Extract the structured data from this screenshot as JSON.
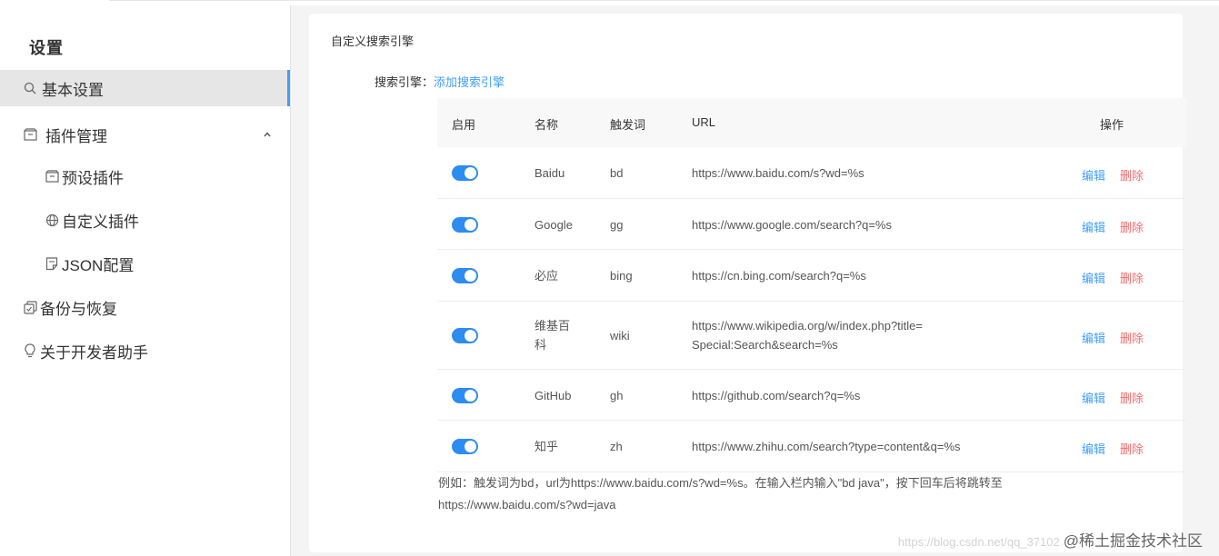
{
  "sidebar": {
    "title": "设置",
    "items": [
      {
        "label": "基本设置",
        "icon": "search-icon"
      },
      {
        "label": "插件管理",
        "icon": "box-icon"
      },
      {
        "label": "预设插件",
        "icon": "box-icon"
      },
      {
        "label": "自定义插件",
        "icon": "globe-icon"
      },
      {
        "label": "JSON配置",
        "icon": "document-icon"
      },
      {
        "label": "备份与恢复",
        "icon": "copy-icon"
      },
      {
        "label": "关于开发者助手",
        "icon": "lightbulb-icon"
      }
    ]
  },
  "card": {
    "title": "自定义搜索引擎",
    "engine_label": "搜索引擎：",
    "add_link": "添加搜索引擎"
  },
  "table": {
    "headers": {
      "enable": "启用",
      "name": "名称",
      "keyword": "触发词",
      "url": "URL",
      "actions": "操作"
    },
    "edit_label": "编辑",
    "delete_label": "删除",
    "rows": [
      {
        "name": "Baidu",
        "keyword": "bd",
        "url": "https://www.baidu.com/s?wd=%s",
        "enabled": true
      },
      {
        "name": "Google",
        "keyword": "gg",
        "url": "https://www.google.com/search?q=%s",
        "enabled": true
      },
      {
        "name": "必应",
        "keyword": "bing",
        "url": "https://cn.bing.com/search?q=%s",
        "enabled": true
      },
      {
        "name": "维基百科",
        "keyword": "wiki",
        "url": "https://www.wikipedia.org/w/index.php?title=Special:Search&search=%s",
        "enabled": true
      },
      {
        "name": "GitHub",
        "keyword": "gh",
        "url": "https://github.com/search?q=%s",
        "enabled": true
      },
      {
        "name": "知乎",
        "keyword": "zh",
        "url": "https://www.zhihu.com/search?type=content&q=%s",
        "enabled": true
      }
    ]
  },
  "note": {
    "line1": "例如：触发词为bd，url为https://www.baidu.com/s?wd=%s。在输入栏内输入\"bd java\"，按下回车后将跳转至",
    "line2": "https://www.baidu.com/s?wd=java"
  },
  "watermark": {
    "faint": "https://blog.csdn.net/qq_37102",
    "main": "@稀土掘金技术社区"
  },
  "colors": {
    "accent": "#409eff",
    "danger": "#f56c6c",
    "switch": "#2d8cf0"
  }
}
